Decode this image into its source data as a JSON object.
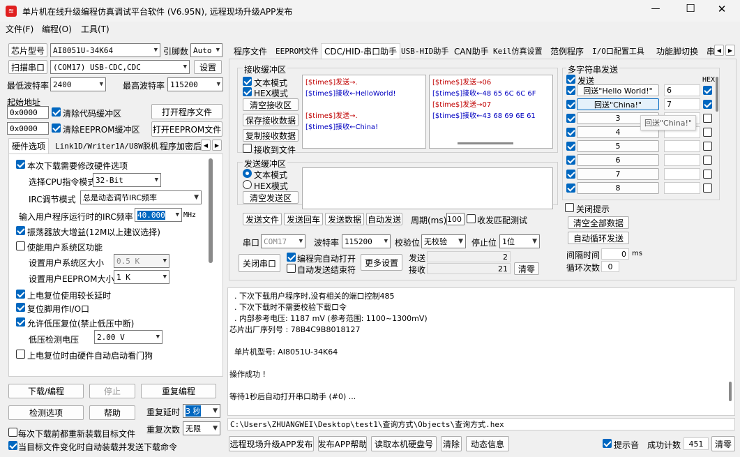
{
  "window": {
    "title": "单片机在线升级编程仿真调试平台软件 (V6.95N), 远程现场升级APP发布",
    "minimize": "—",
    "maximize": "☐",
    "close": "✕"
  },
  "menu": [
    "文件(F)",
    "编程(O)",
    "工具(T)"
  ],
  "left": {
    "chip_label": "芯片型号",
    "chip_value": "AI8051U-34K64",
    "pins_label": "引脚数",
    "pins_value": "Auto",
    "scan_label": "扫描串口",
    "port_value": "(COM17) USB-CDC,CDC",
    "settings_label": "设置",
    "min_baud_label": "最低波特率",
    "min_baud_value": "2400",
    "max_baud_label": "最高波特率",
    "max_baud_value": "115200",
    "start_addr_label": "起始地址",
    "addr1": "0x0000",
    "clear_code": "清除代码缓冲区",
    "open_prog": "打开程序文件",
    "addr2": "0x0000",
    "clear_eeprom": "清除EEPROM缓冲区",
    "open_eeprom": "打开EEPROM文件",
    "tabs": [
      "硬件选项",
      "Link1D/Writer1A/U8W脱机",
      "程序加密后"
    ],
    "hw": {
      "modify": "本次下载需要修改硬件选项",
      "cpu_label": "选择CPU指令模式",
      "cpu_value": "32-Bit",
      "irc_label": "IRC调节模式",
      "irc_value": "总是动态调节IRC频率",
      "freq_label": "输入用户程序运行时的IRC频率",
      "freq_value": "40.000",
      "freq_unit": "MHz",
      "osc": "振荡器放大增益(12M以上建议选择)",
      "sysarea": "使能用户系统区功能",
      "sys_size_label": "设置用户系统区大小",
      "sys_size_value": "0.5 K",
      "eeprom_size_label": "设置用户EEPROM大小",
      "eeprom_size_value": "1  K",
      "long_delay": "上电复位使用较长延时",
      "reset_io": "复位脚用作I/O口",
      "lvr": "允许低压复位(禁止低压中断)",
      "lvd_label": "低压检测电压",
      "lvd_value": "2.00 V",
      "wdt": "上电复位时由硬件自动启动看门狗"
    },
    "download": "下载/编程",
    "stop": "停止",
    "reprogram": "重复编程",
    "detect": "检测选项",
    "help": "帮助",
    "repeat_delay_label": "重复延时",
    "repeat_delay_value": "3 秒",
    "repeat_count_label": "重复次数",
    "repeat_count_value": "无限",
    "reload": "每次下载前都重新装载目标文件",
    "auto_load": "当目标文件变化时自动装载并发送下载命令"
  },
  "right": {
    "tabs": [
      "程序文件",
      "EEPROM文件",
      "CDC/HID-串口助手",
      "USB-HID助手",
      "CAN助手",
      "Keil仿真设置",
      "范例程序",
      "I/O口配置工具",
      "功能脚切换",
      "串"
    ],
    "recv_title": "接收缓冲区",
    "text_mode": "文本模式",
    "hex_mode": "HEX模式",
    "clear_recv": "清空接收区",
    "save_recv": "保存接收数据",
    "copy_recv": "复制接收数据",
    "recv_to_file": "接收到文件",
    "recv_text": [
      {
        "t": "[$time$]发送→.",
        "c": "red"
      },
      {
        "t": "[$time$]接收←HelloWorld!",
        "c": "blue"
      },
      {
        "t": "",
        "c": "blue"
      },
      {
        "t": "[$time$]发送→.",
        "c": "red"
      },
      {
        "t": "[$time$]接收←China!",
        "c": "blue"
      }
    ],
    "recv_hex": [
      {
        "t": "[$time$]发送→06",
        "c": "red"
      },
      {
        "t": "[$time$]接收←48 65 6C 6C 6F",
        "c": "blue"
      },
      {
        "t": "[$time$]发送→07",
        "c": "red"
      },
      {
        "t": "[$time$]接收←43 68 69 6E 61",
        "c": "blue"
      }
    ],
    "send_title": "发送缓冲区",
    "send_text_mode": "文本模式",
    "send_hex_mode": "HEX模式",
    "clear_send": "清空发送区",
    "send_file": "发送文件",
    "send_enter": "发送回车",
    "send_data": "发送数据",
    "auto_send": "自动发送",
    "period_label": "周期(ms)",
    "period_value": "100",
    "match_test": "收发匹配测试",
    "port_label": "串口",
    "port_value": "COM17",
    "baud_label": "波特率",
    "baud_value": "115200",
    "parity_label": "校验位",
    "parity_value": "无校验",
    "stop_label": "停止位",
    "stop_value": "1位",
    "close_port": "关闭串口",
    "auto_open": "编程完自动打开",
    "auto_end": "自动发送结束符",
    "more": "更多设置",
    "send_cnt_label": "发送",
    "send_cnt": "2",
    "recv_cnt_label": "接收",
    "recv_cnt": "21",
    "clear_cnt": "清零",
    "multi_title": "多字符串发送",
    "send_col": "发送",
    "hex_col": "HEX",
    "multi": [
      {
        "label": "回送\"Hello World!\"",
        "val": "6",
        "hex": true
      },
      {
        "label": "回送\"China!\"",
        "val": "7",
        "hex": true
      },
      {
        "label": "3",
        "val": "",
        "hex": false
      },
      {
        "label": "4",
        "val": "",
        "hex": false
      },
      {
        "label": "5",
        "val": "",
        "hex": false
      },
      {
        "label": "6",
        "val": "",
        "hex": false
      },
      {
        "label": "7",
        "val": "",
        "hex": false
      },
      {
        "label": "8",
        "val": "",
        "hex": false
      }
    ],
    "tooltip": "回送\"China!\"",
    "close_hint": "关闭提示",
    "clear_all": "清空全部数据",
    "auto_loop": "自动循环发送",
    "interval_label": "间隔时间",
    "interval_value": "0",
    "interval_unit": "ms",
    "loop_label": "循环次数",
    "loop_value": "0"
  },
  "log": [
    "  . 下次下载用户程序时,没有相关的端口控制485",
    "  . 下次下载时不需要校验下载口令",
    "  . 内部参考电压: 1187 mV (参考范围: 1100~1300mV)",
    "芯片出厂序列号 : 78B4C9B8018127",
    "",
    "  单片机型号: AI8051U-34K64",
    "",
    "操作成功 !",
    "",
    "等待1秒后自动打开串口助手 (#0) ..."
  ],
  "path": "C:\\Users\\ZHUANGWEI\\Desktop\\test1\\查询方式\\Objects\\查询方式.hex",
  "bottom": {
    "remote": "远程现场升级APP发布",
    "app_help": "发布APP帮助",
    "read_disk": "读取本机硬盘号",
    "clear": "清除",
    "news": "动态信息",
    "beep": "提示音",
    "success_label": "成功计数",
    "success_value": "451",
    "clear_count": "清零"
  }
}
